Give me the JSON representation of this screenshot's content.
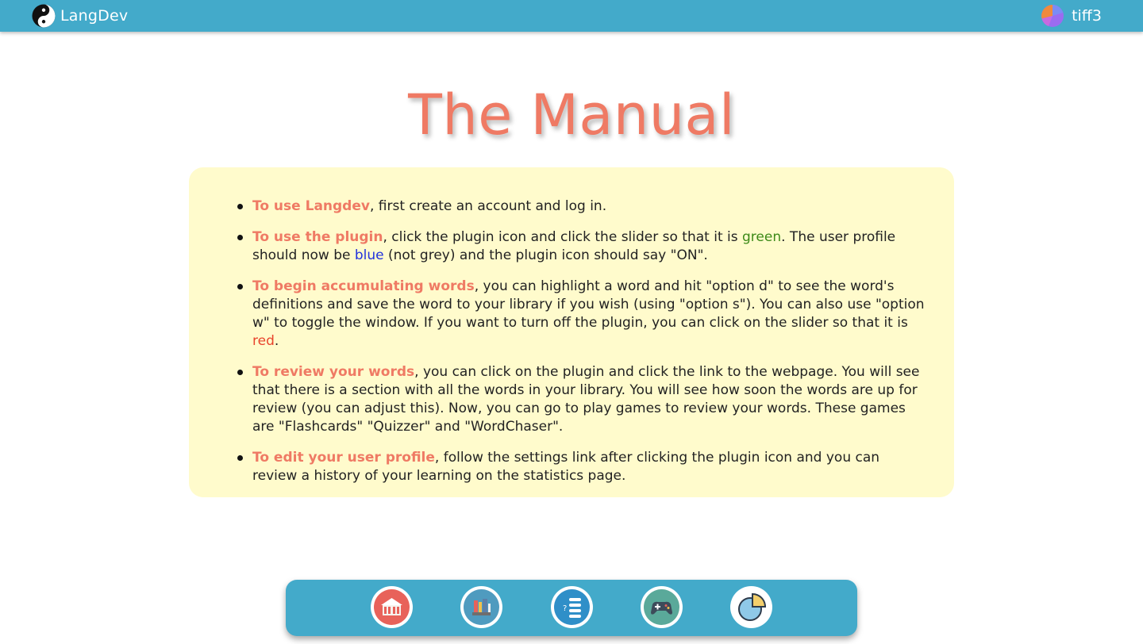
{
  "app": {
    "name": "LangDev",
    "username": "tiff3",
    "accent_color": "#43aaca",
    "highlight_color": "#ef7a64",
    "logo_icon": "yin-yang-icon",
    "avatar_icon": "user-avatar-icon"
  },
  "page": {
    "title": "The Manual"
  },
  "manual": {
    "items": [
      {
        "heading": "To use Langdev",
        "text": ", first create an account and log in."
      },
      {
        "heading": "To use the plugin",
        "text_a": ", click the plugin icon and click the slider so that it is ",
        "green": "green",
        "text_b": ". The user profile should now be ",
        "blue": "blue",
        "text_c": " (not grey) and the plugin icon should say \"ON\"."
      },
      {
        "heading": "To begin accumulating words",
        "text_a": ", you can highlight a word and hit \"option d\" to see the word's definitions and save the word to your library if you wish (using \"option s\"). You can also use \"option w\" to toggle the window. If you want to turn off the plugin, you can click on the slider so that it is ",
        "red": "red",
        "text_b": "."
      },
      {
        "heading": "To review your words",
        "text": ", you can click on the plugin and click the link to the webpage. You will see that there is a section with all the words in your library. You will see how soon the words are up for review (you can adjust this). Now, you can go to play games to review your words. These games are \"Flashcards\" \"Quizzer\" and \"WordChaser\"."
      },
      {
        "heading": "To edit your user profile",
        "text": ", follow the settings link after clicking the plugin icon and you can review a history of your learning on the statistics page."
      }
    ],
    "colors": {
      "green": "#3d8a18",
      "blue": "#2233dd",
      "red": "#e8442c",
      "box_background": "#fffbcc"
    }
  },
  "dock": {
    "buttons": [
      {
        "icon": "home-icon",
        "bg": "#e8625a"
      },
      {
        "icon": "library-books-icon",
        "bg": "#4f9bbf"
      },
      {
        "icon": "quiz-list-icon",
        "bg": "#2f8fc8"
      },
      {
        "icon": "gamepad-icon",
        "bg": "#5aa99a"
      },
      {
        "icon": "pie-chart-icon",
        "bg": "#8fc9e8"
      }
    ]
  }
}
